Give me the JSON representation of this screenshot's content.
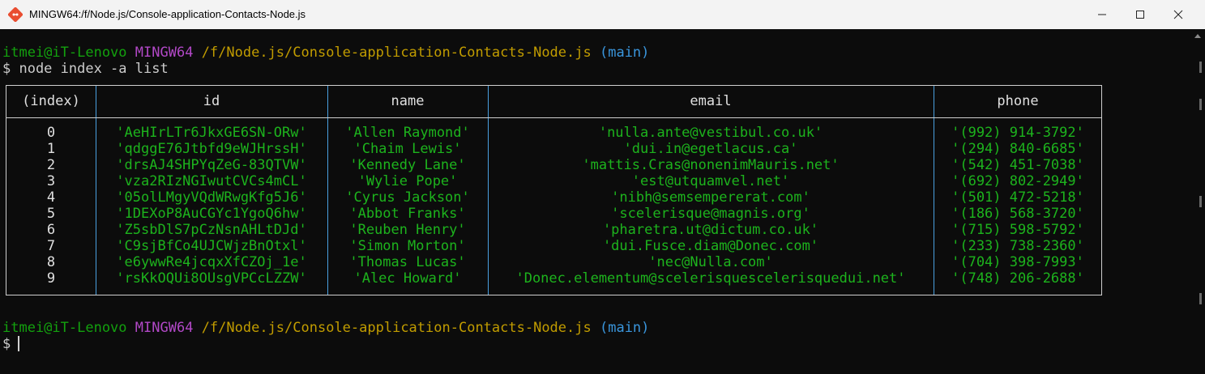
{
  "window": {
    "title": "MINGW64:/f/Node.js/Console-application-Contacts-Node.js",
    "app_icon": "git-bash-icon",
    "controls": [
      "minimize-icon",
      "maximize-icon",
      "close-icon"
    ]
  },
  "prompt1": {
    "user_host": "itmei@iT-Lenovo",
    "env": "MINGW64",
    "path": "/f/Node.js/Console-application-Contacts-Node.js",
    "branch": "(main)"
  },
  "command": "$ node index -a list",
  "table": {
    "headers": [
      "(index)",
      "id",
      "name",
      "email",
      "phone"
    ],
    "rows": [
      {
        "index": "0",
        "id": "'AeHIrLTr6JkxGE6SN-ORw'",
        "name": "'Allen Raymond'",
        "email": "'nulla.ante@vestibul.co.uk'",
        "phone": "'(992) 914-3792'"
      },
      {
        "index": "1",
        "id": "'qdggE76Jtbfd9eWJHrssH'",
        "name": "'Chaim Lewis'",
        "email": "'dui.in@egetlacus.ca'",
        "phone": "'(294) 840-6685'"
      },
      {
        "index": "2",
        "id": "'drsAJ4SHPYqZeG-83QTVW'",
        "name": "'Kennedy Lane'",
        "email": "'mattis.Cras@nonenimMauris.net'",
        "phone": "'(542) 451-7038'"
      },
      {
        "index": "3",
        "id": "'vza2RIzNGIwutCVCs4mCL'",
        "name": "'Wylie Pope'",
        "email": "'est@utquamvel.net'",
        "phone": "'(692) 802-2949'"
      },
      {
        "index": "4",
        "id": "'05olLMgyVQdWRwgKfg5J6'",
        "name": "'Cyrus Jackson'",
        "email": "'nibh@semsempererat.com'",
        "phone": "'(501) 472-5218'"
      },
      {
        "index": "5",
        "id": "'1DEXoP8AuCGYc1YgoQ6hw'",
        "name": "'Abbot Franks'",
        "email": "'scelerisque@magnis.org'",
        "phone": "'(186) 568-3720'"
      },
      {
        "index": "6",
        "id": "'Z5sbDlS7pCzNsnAHLtDJd'",
        "name": "'Reuben Henry'",
        "email": "'pharetra.ut@dictum.co.uk'",
        "phone": "'(715) 598-5792'"
      },
      {
        "index": "7",
        "id": "'C9sjBfCo4UJCWjzBnOtxl'",
        "name": "'Simon Morton'",
        "email": "'dui.Fusce.diam@Donec.com'",
        "phone": "'(233) 738-2360'"
      },
      {
        "index": "8",
        "id": "'e6ywwRe4jcqxXfCZOj_1e'",
        "name": "'Thomas Lucas'",
        "email": "'nec@Nulla.com'",
        "phone": "'(704) 398-7993'"
      },
      {
        "index": "9",
        "id": "'rsKkOQUi8OUsgVPCcLZZW'",
        "name": "'Alec Howard'",
        "email": "'Donec.elementum@scelerisquescelerisquedui.net'",
        "phone": "'(748) 206-2688'"
      }
    ]
  },
  "prompt2": {
    "user_host": "itmei@iT-Lenovo",
    "env": "MINGW64",
    "path": "/f/Node.js/Console-application-Contacts-Node.js",
    "branch": "(main)"
  },
  "input_line": "$ ",
  "colors": {
    "user_host": "#13a10e",
    "env": "#b148c6",
    "path": "#c19c00",
    "branch": "#3a96dd",
    "values": "#1db31d",
    "border_vertical": "#4aa0e0"
  }
}
